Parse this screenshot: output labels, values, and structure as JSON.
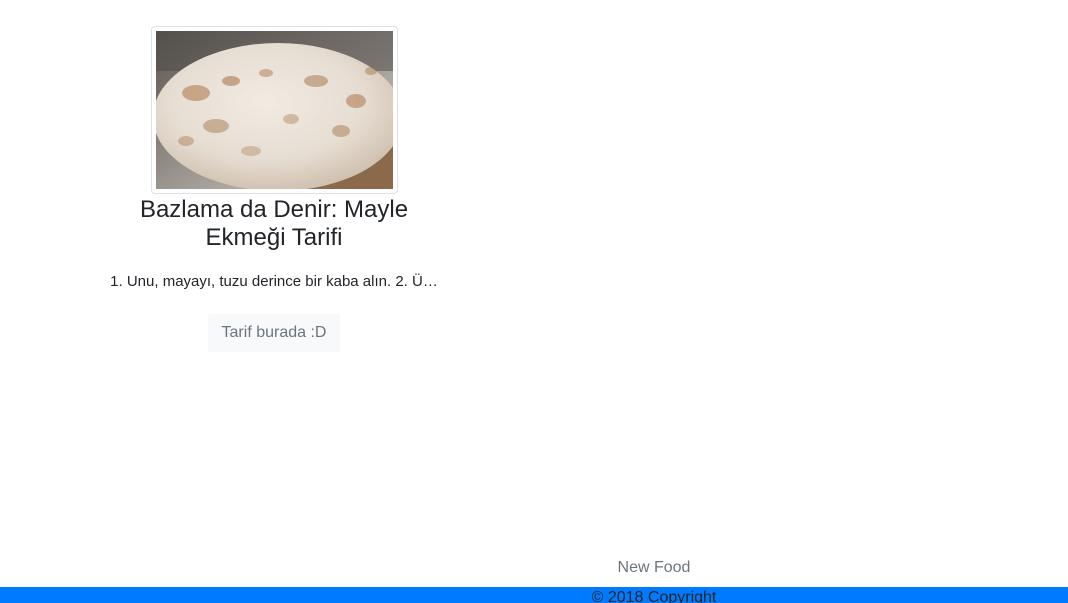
{
  "recipe_card": {
    "image_alt": "bazlama-bread-photo",
    "title": "Bazlama da Denir: Mayle Ekmeği Tarifi",
    "excerpt": "1. Unu, mayayı, tuzu derince bir kaba alın. 2. Ü…",
    "button_label": "Tarif burada :D"
  },
  "footer": {
    "nav_link": "New Food",
    "copyright": "© 2018 Copyright"
  },
  "colors": {
    "footer_bar": "#007bff",
    "button_bg": "#f8f9fa",
    "muted_text": "#6c757d"
  }
}
